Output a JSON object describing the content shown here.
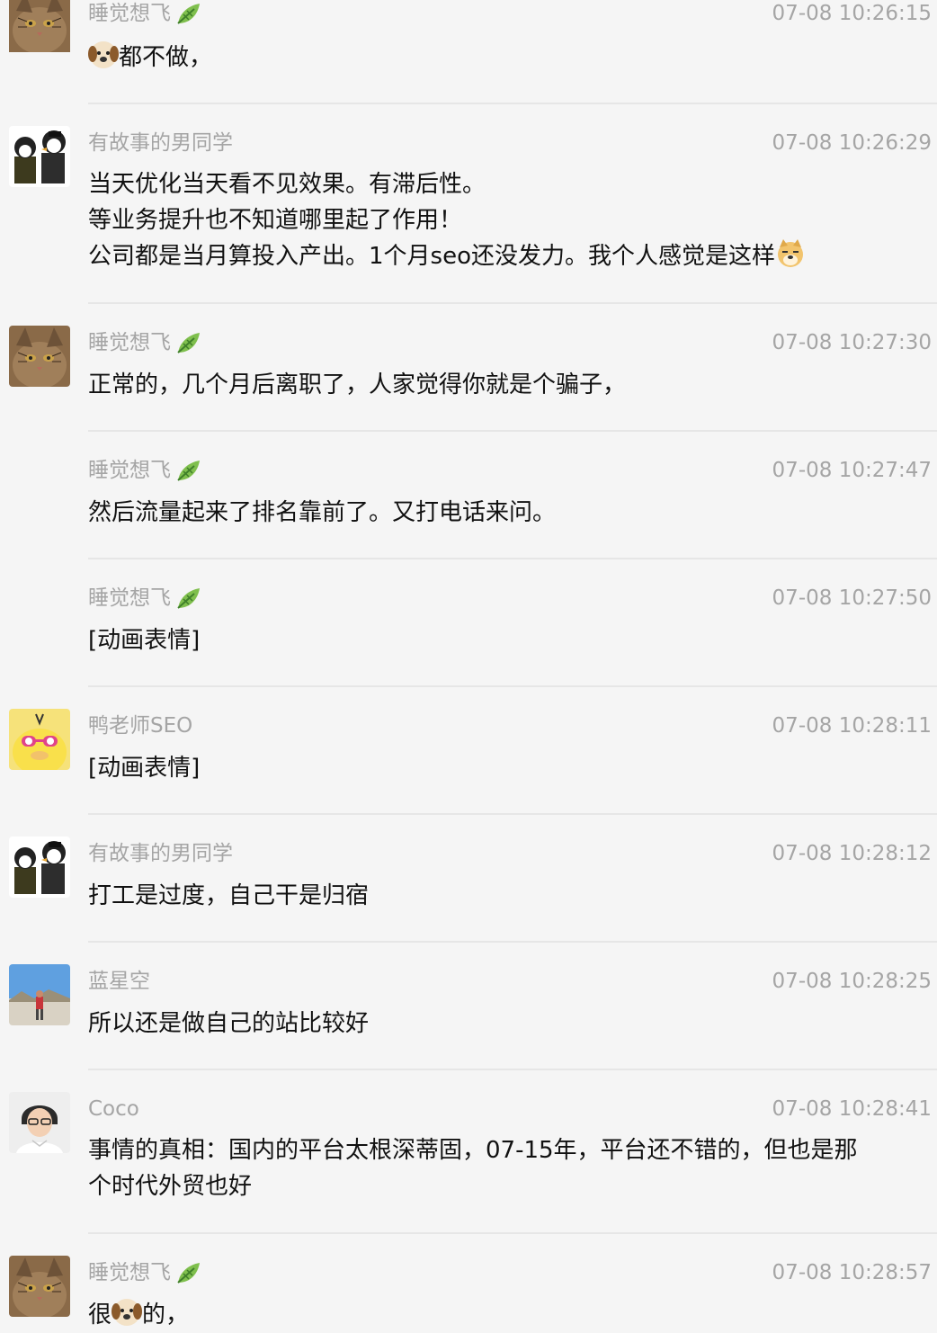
{
  "messages": [
    {
      "sender": "睡觉想飞",
      "time": "07-08 10:26:15",
      "avatar": "cat-avatar",
      "badge": "leaf-icon",
      "text_before": "",
      "emoji": "dog-face-emoji",
      "text_after": "都不做，"
    },
    {
      "sender": "有故事的男同学",
      "time": "07-08 10:26:29",
      "avatar": "penguins-avatar",
      "lines": [
        "当天优化当天看不见效果。有滞后性。",
        "等业务提升也不知道哪里起了作用！",
        "公司都是当月算投入产出。1个月seo还没发力。我个人感觉是这样"
      ],
      "trailing_emoji": "doge-emoji"
    },
    {
      "sender": "睡觉想飞",
      "time": "07-08 10:27:30",
      "avatar": "cat-avatar",
      "badge": "leaf-icon",
      "text": "正常的，几个月后离职了，人家觉得你就是个骗子，"
    },
    {
      "sender": "睡觉想飞",
      "time": "07-08 10:27:47",
      "badge": "leaf-icon",
      "text": "然后流量起来了排名靠前了。又打电话来问。"
    },
    {
      "sender": "睡觉想飞",
      "time": "07-08 10:27:50",
      "badge": "leaf-icon",
      "text": "[动画表情]"
    },
    {
      "sender": "鸭老师SEO",
      "time": "07-08 10:28:11",
      "avatar": "duck-avatar",
      "text": "[动画表情]"
    },
    {
      "sender": "有故事的男同学",
      "time": "07-08 10:28:12",
      "avatar": "penguins-avatar",
      "text": "打工是过度，自己干是归宿"
    },
    {
      "sender": "蓝星空",
      "time": "07-08 10:28:25",
      "avatar": "landscape-avatar",
      "text": "所以还是做自己的站比较好"
    },
    {
      "sender": "Coco",
      "time": "07-08 10:28:41",
      "avatar": "person-avatar",
      "lines": [
        "事情的真相：国内的平台太根深蒂固，07-15年，平台还不错的，但也是那",
        "个时代外贸也好"
      ]
    },
    {
      "sender": "睡觉想飞",
      "time": "07-08 10:28:57",
      "avatar": "cat-avatar",
      "badge": "leaf-icon",
      "text_before": "很",
      "emoji": "dog-face-emoji",
      "text_after": "的，"
    }
  ],
  "colors": {
    "background": "#f5f5f5",
    "meta_text": "#a5a5a5",
    "body_text": "#111111",
    "divider": "#e6e6e6"
  }
}
